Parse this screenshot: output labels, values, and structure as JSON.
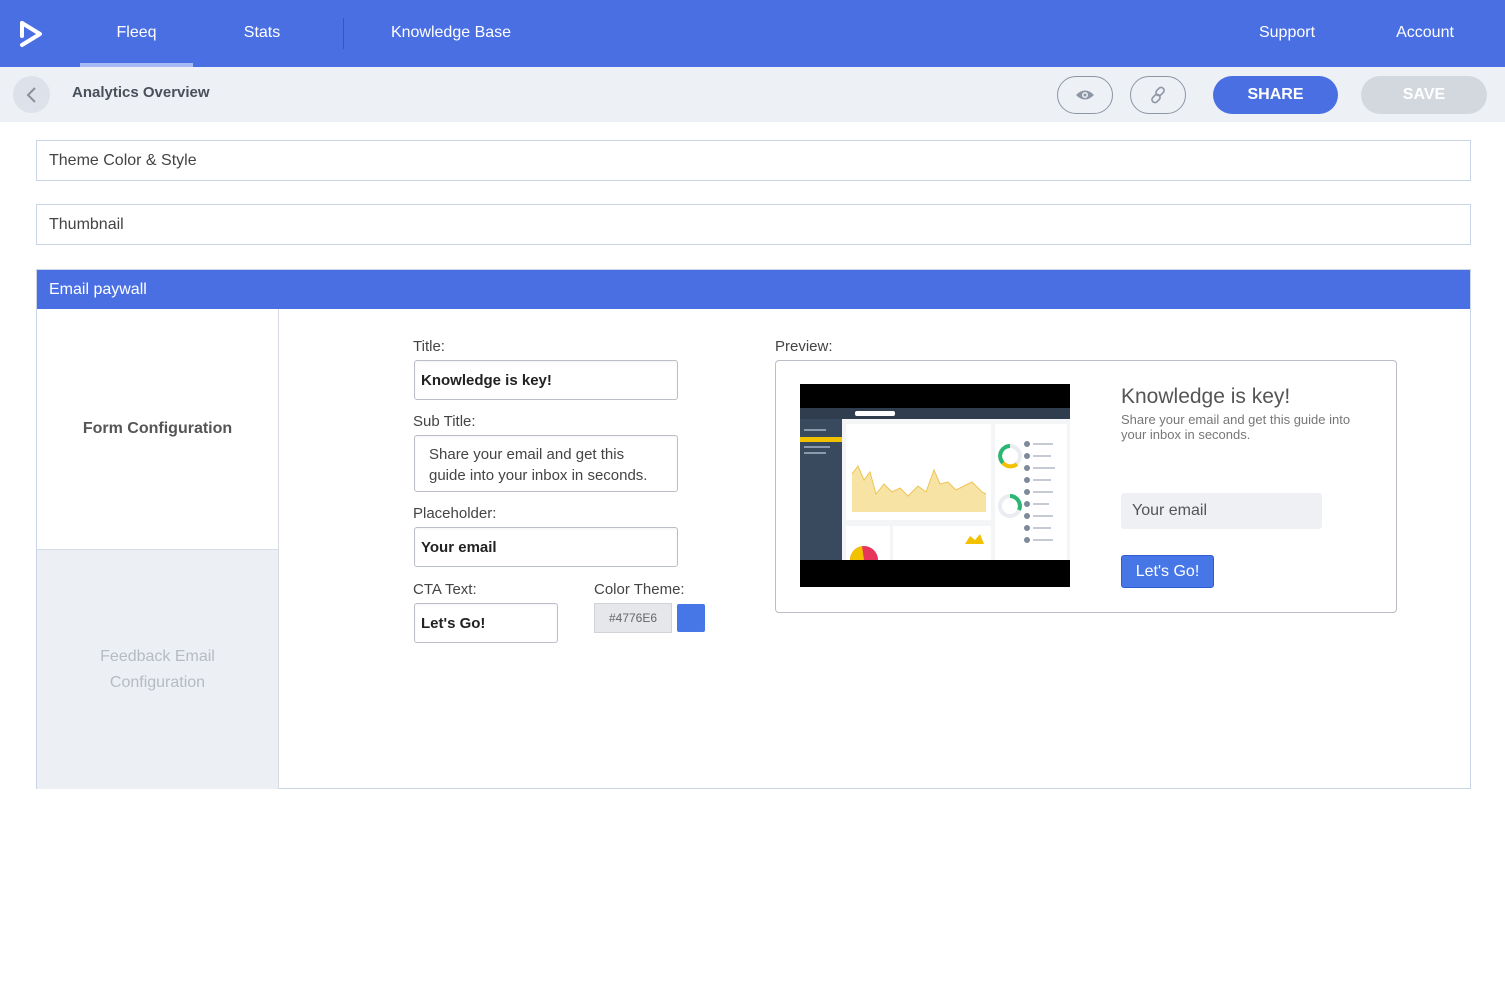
{
  "nav": {
    "items": [
      {
        "label": "Fleeq"
      },
      {
        "label": "Stats"
      },
      {
        "label": "Knowledge Base"
      },
      {
        "label": "Support"
      },
      {
        "label": "Account"
      }
    ],
    "active": "Fleeq"
  },
  "subbar": {
    "title": "Analytics Overview",
    "share_label": "SHARE",
    "save_label": "SAVE",
    "icons": [
      "back-chevron-icon",
      "eye-icon",
      "link-icon"
    ]
  },
  "sections": {
    "theme": "Theme Color & Style",
    "thumbnail": "Thumbnail",
    "paywall": "Email paywall"
  },
  "side_tabs": {
    "form": "Form Configuration",
    "feedback": "Feedback Email Configuration"
  },
  "form": {
    "title_label": "Title:",
    "title_value": "Knowledge is key!",
    "subtitle_label": "Sub Title:",
    "subtitle_value": "Share your email and get this guide into your inbox in seconds.",
    "placeholder_label": "Placeholder:",
    "placeholder_value": "Your email",
    "cta_label": "CTA Text:",
    "cta_value": "Let's Go!",
    "color_label": "Color Theme:",
    "color_value": "#4776E6"
  },
  "preview": {
    "label": "Preview:",
    "title": "Knowledge is key!",
    "subtitle": "Share your email and get this guide into your inbox in seconds.",
    "input_placeholder": "Your email",
    "cta": "Let's Go!"
  },
  "colors": {
    "brand": "#4a6fe3",
    "theme": "#4776e6"
  }
}
